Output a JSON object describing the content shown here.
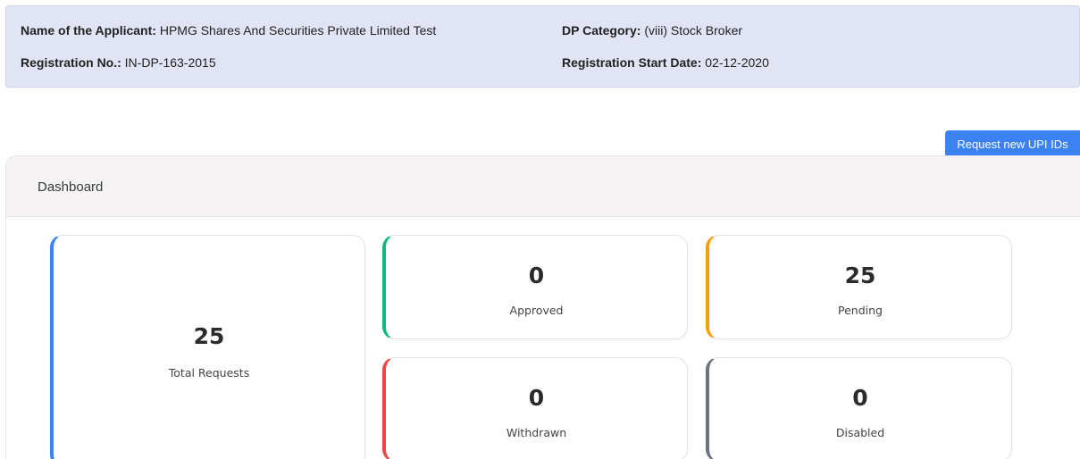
{
  "applicant": {
    "name_label": "Name of the Applicant:",
    "name_value": "HPMG Shares And Securities Private Limited Test",
    "registration_label": "Registration No.:",
    "registration_value": "IN-DP-163-2015",
    "category_label": "DP Category:",
    "category_value": "(viii) Stock Broker",
    "start_date_label": "Registration Start Date:",
    "start_date_value": "02-12-2020"
  },
  "actions": {
    "request_button_label": "Request new UPI IDs",
    "request_button_color": "#3b82f6"
  },
  "dashboard": {
    "title": "Dashboard",
    "stats": {
      "total": {
        "value": "25",
        "label": "Total Requests",
        "accent": "#3b82f6"
      },
      "approved": {
        "value": "0",
        "label": "Approved",
        "accent": "#10b981"
      },
      "pending": {
        "value": "25",
        "label": "Pending",
        "accent": "#f59e0b"
      },
      "withdrawn": {
        "value": "0",
        "label": "Withdrawn",
        "accent": "#ef4444"
      },
      "disabled": {
        "value": "0",
        "label": "Disabled",
        "accent": "#6b7280"
      }
    }
  }
}
